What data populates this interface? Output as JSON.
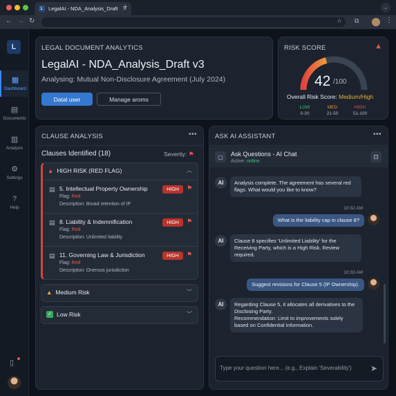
{
  "browser": {
    "tab_title": "LegalAI - NDA_Analysis_Draft v3",
    "tab_logo": "L",
    "traffic_light_colors": [
      "#ef5f58",
      "#f5bd2f",
      "#5cc443"
    ],
    "icons": [
      "back-icon",
      "forward-icon",
      "reload-icon",
      "bookmark-star-icon",
      "extensions-icon",
      "profile-icon",
      "menu-icon"
    ]
  },
  "sidebar": {
    "logo_text": "L",
    "items": [
      {
        "label": "Dashboard",
        "icon": "dashboard-icon",
        "active": true
      },
      {
        "label": "Documents",
        "icon": "documents-icon",
        "active": false
      },
      {
        "label": "Analysis",
        "icon": "analysis-icon",
        "active": false
      },
      {
        "label": "Settings",
        "icon": "settings-icon",
        "active": false
      },
      {
        "label": "Help",
        "icon": "help-icon",
        "active": false
      }
    ]
  },
  "header": {
    "section_title": "LEGAL DOCUMENT ANALYTICS",
    "document_name": "LegalAI - NDA_Analysis_Draft v3",
    "subtitle": "Analysing: Mutual Non-Disclosure Agreement (July 2024)",
    "primary_button": "Datal user",
    "secondary_button": "Manage aroms"
  },
  "risk": {
    "title": "RISK SCORE",
    "score": "42",
    "max": "/100",
    "score_fraction": 0.42,
    "overall_label": "Overall Risk Score:",
    "overall_value": "Medium/High",
    "legend": [
      {
        "label": "LOW",
        "range": "0-20",
        "color": "#48c07a"
      },
      {
        "label": "MED",
        "range": "21-50",
        "color": "#e8913a"
      },
      {
        "label": "HIGH",
        "range": "51-100",
        "color": "#e05a4b"
      }
    ]
  },
  "clauses": {
    "title": "CLAUSE ANALYSIS",
    "count_label": "Clauses Identified (18)",
    "severity_label": "Severity:",
    "high_group": {
      "title": "HIGH RISK (RED FLAG)",
      "items": [
        {
          "name": "5. Intellectual Property Ownership",
          "badge": "HIGH",
          "flag_label": "Flag:",
          "flag_value": "Red",
          "description": "Description: Broad retention of IP"
        },
        {
          "name": "8. Liability & Indemnification",
          "badge": "HIGH",
          "flag_label": "Flag:",
          "flag_value": "Red",
          "description": "Description: Unlimited liability"
        },
        {
          "name": "11. Governing Law & Jurisdiction",
          "badge": "HIGH",
          "flag_label": "Flag:",
          "flag_value": "Red",
          "description": "Description: Onerous jurisdiction"
        }
      ]
    },
    "medium_group": {
      "title": "Medium Risk"
    },
    "low_group": {
      "title": "Low Risk"
    }
  },
  "chat": {
    "title": "ASK AI ASSISTANT",
    "header_title": "Ask Questions - AI Chat",
    "status_label": "Active:",
    "status_value": "online",
    "ai_avatar": "AI",
    "messages": [
      {
        "role": "ai",
        "text": "Analysis complete. The agreement has several red flags. What would you like to know?"
      },
      {
        "role": "user",
        "time": "10:32 AM",
        "text": "What is the liability cap in clause 8?"
      },
      {
        "role": "ai",
        "text": "Clause 8 specifies 'Unlimited Liability' for the Receiving Party, which is a High Risk. Review required."
      },
      {
        "role": "user",
        "time": "10:33 AM",
        "text": "Suggest revisions for Clause 5 (IP Ownership)."
      },
      {
        "role": "ai",
        "text": "Regarding Clause 5, it allocates all derivatives to the Disclosing Party.\nRecommendation: Limit to improvements solely based on Confidential Information."
      }
    ],
    "input_placeholder": "Type your question here... (e.g., Explain 'Severability')"
  }
}
